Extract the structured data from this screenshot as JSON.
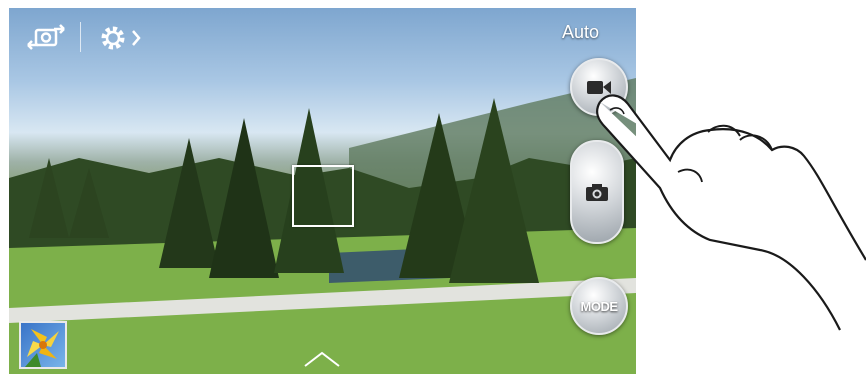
{
  "camera": {
    "mode_label": "Auto",
    "mode_button_label": "MODE"
  },
  "icons": {
    "switch_camera": "switch-camera-icon",
    "settings": "gear-icon",
    "record": "video-camera-icon",
    "capture": "camera-icon",
    "gallery": "gallery-thumbnail",
    "expand": "chevron-up-icon"
  },
  "colors": {
    "overlay_text": "#ffffff",
    "button_silver": "#c8cdd2",
    "button_icon": "#2b2b2b"
  }
}
